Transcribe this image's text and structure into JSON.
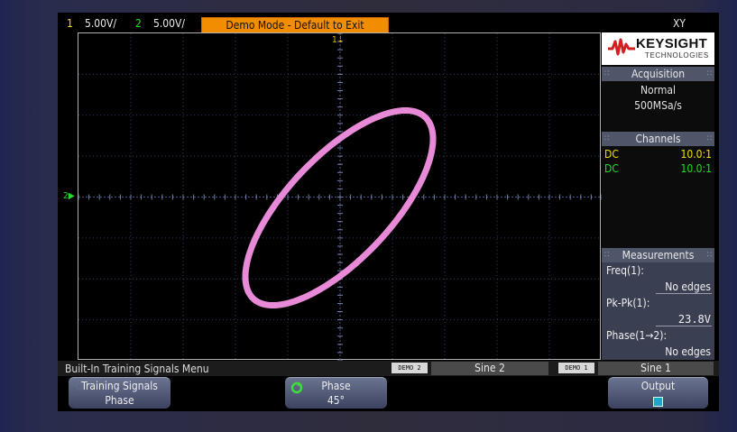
{
  "top_bar": {
    "ch1_number": "1",
    "ch1_scale": "5.00V/",
    "ch2_number": "2",
    "ch2_scale": "5.00V/",
    "demo_banner": "Demo Mode - Default to Exit",
    "timebase_mode": "XY"
  },
  "markers": {
    "trigger": "1",
    "ch2": "2"
  },
  "logo": {
    "name": "KEYSIGHT",
    "tagline": "TECHNOLOGIES"
  },
  "acquisition": {
    "title": "Acquisition",
    "mode": "Normal",
    "rate": "500MSa/s"
  },
  "channels": {
    "title": "Channels",
    "items": [
      {
        "coupling": "DC",
        "probe": "10.0:1",
        "color": "#f0e000"
      },
      {
        "coupling": "DC",
        "probe": "10.0:1",
        "color": "#22dd22"
      }
    ]
  },
  "measurements": {
    "title": "Measurements",
    "items": [
      {
        "label": "Freq(1):",
        "value": "No edges"
      },
      {
        "label": "Pk-Pk(1):",
        "value": "23.8V"
      },
      {
        "label": "Phase(1→2):",
        "value": "No edges"
      }
    ]
  },
  "status_row": {
    "menu_title": "Built-In Training Signals Menu",
    "demo2_badge": "DEMO 2",
    "demo2_signal": "Sine 2",
    "demo1_badge": "DEMO 1",
    "demo1_signal": "Sine 1"
  },
  "softkeys": [
    {
      "top": "Training Signals",
      "bottom": "Phase"
    },
    {
      "top": "Phase",
      "bottom": "45°"
    },
    {
      "top": "Output",
      "bottom": ""
    }
  ],
  "trace": {
    "color": "#e88ad8",
    "display": "XY Lissajous",
    "phase_deg": 45
  }
}
